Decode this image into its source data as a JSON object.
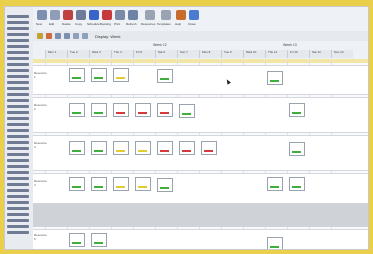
{
  "toolbar": {
    "buttons": [
      {
        "label": "New",
        "icon": "new-document-icon",
        "color": "#7d8fb0"
      },
      {
        "label": "Edit",
        "icon": "edit-icon",
        "color": "#8f9db8"
      },
      {
        "label": "Delete",
        "icon": "delete-icon",
        "color": "#c04040"
      },
      {
        "label": "Copy",
        "icon": "copy-icon",
        "color": "#6d7d99"
      },
      {
        "label": "Schedule",
        "icon": "calendar-icon",
        "color": "#3a64c8"
      },
      {
        "label": "Booking",
        "icon": "book-icon",
        "color": "#c53a3a"
      },
      {
        "label": "Print",
        "icon": "printer-icon",
        "color": "#7a8aa7"
      },
      {
        "label": "Refresh",
        "icon": "refresh-icon",
        "color": "#6e82a6"
      },
      {
        "label": "Resources",
        "icon": "people-icon",
        "color": "#9aa3b3"
      },
      {
        "label": "Templates",
        "icon": "template-icon",
        "color": "#9aa3b3"
      },
      {
        "label": "Help",
        "icon": "help-icon",
        "color": "#c86b2e"
      },
      {
        "label": "Close",
        "icon": "close-icon",
        "color": "#4a7bd0"
      }
    ]
  },
  "subbar": {
    "label": "Display: Week"
  },
  "header": {
    "weeks": [
      "Week 12",
      "Week 13"
    ]
  },
  "dates": [
    "Mon 1",
    "Tue 2",
    "Wed 3",
    "Thu 4",
    "Fri 5",
    "Sat 6",
    "Sun 7",
    "Mon 8",
    "Tue 9",
    "Wed 10",
    "Thu 11",
    "Fri 12",
    "Sat 13",
    "Sun 14"
  ],
  "rows": [
    "Resource 1",
    "Resource 2",
    "Resource 3",
    "Resource 4",
    "Resource 5",
    "Resource 6"
  ],
  "colors": {
    "green": "#3fae3f",
    "red": "#d63b3b",
    "yellow": "#e2cc2e",
    "frame": "#e9cf4a"
  }
}
